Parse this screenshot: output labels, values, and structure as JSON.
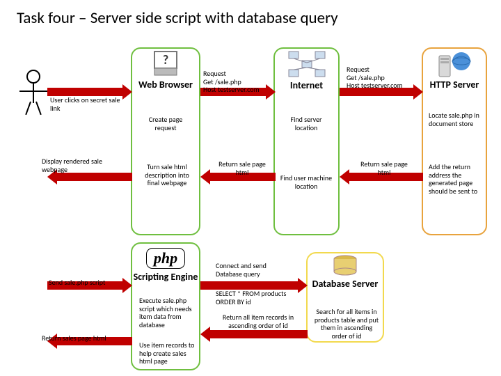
{
  "title": "Task four – Server side script with database query",
  "nodes": {
    "browser": "Web Browser",
    "internet": "Internet",
    "httpserver": "HTTP Server",
    "scripting": "Scripting Engine",
    "dbserver": "Database Server",
    "php": "php"
  },
  "labels": {
    "userclick": "User clicks on secret sale link",
    "req1": "Request\nGet /sale.php\nHost testserver.com",
    "req2": "Request\nGet /sale.php\nHost testserver.com",
    "createreq": "Create page request",
    "findserver": "Find server location",
    "locate": "Locate sale.php in document store",
    "display": "Display rendered sale webpage",
    "turnhtml": "Turn sale html description into final webpage",
    "returnpage1": "Return sale page html",
    "returnpage2": "Return sale page html",
    "findmachine": "Find user machine location",
    "addreturn": "Add the return address the generated page should be sent to",
    "sendscript": "Send sale.php script",
    "execute": "Execute sale.php script which needs item data from database",
    "connectdb": "Connect and send Database query",
    "select": "SELECT * FROM products ORDER BY id",
    "returnhtml2": "Return sales page html",
    "userecords": "Use item records to help create sales html page",
    "returnitems": "Return all item records in ascending order of id",
    "searchitems": "Search for all items in products table and put them in ascending order of id"
  }
}
